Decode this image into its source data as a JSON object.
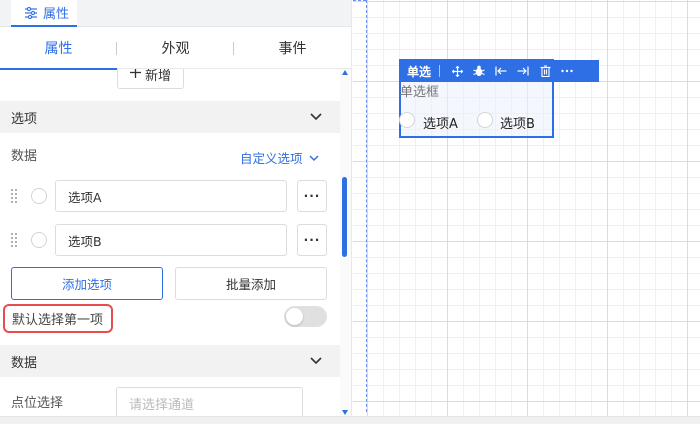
{
  "panel": {
    "tab_label": "属性",
    "tab_icon": "sliders-icon",
    "subtabs": [
      "属性",
      "外观",
      "事件"
    ],
    "add_top_label": "新增",
    "accent_color": "#2f6fe6",
    "highlight_color": "#e84d4d"
  },
  "options_section": {
    "title": "选项",
    "data_label": "数据",
    "custom_options_label": "自定义选项",
    "items": [
      {
        "value": "选项A"
      },
      {
        "value": "选项B"
      }
    ],
    "more_label": "···",
    "add_option_label": "添加选项",
    "batch_add_label": "批量添加",
    "default_first_label": "默认选择第一项",
    "default_first_enabled": false
  },
  "data_section": {
    "title": "数据",
    "point_select_label": "点位选择",
    "channel_placeholder": "请选择通道"
  },
  "widget": {
    "toolbar_title": "单选",
    "toolbar_icons": [
      "move-icon",
      "bug-icon",
      "align-left-icon",
      "align-right-icon",
      "delete-icon",
      "more-icon"
    ],
    "label": "单选框",
    "options": [
      "选项A",
      "选项B"
    ]
  }
}
